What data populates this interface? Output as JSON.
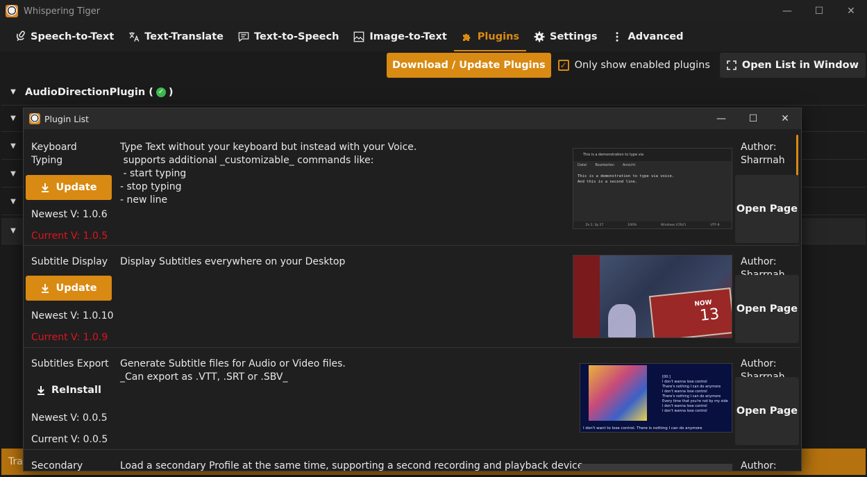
{
  "app": {
    "title": "Whispering Tiger",
    "window_controls": [
      "—",
      "☐",
      "✕"
    ]
  },
  "tabs": [
    {
      "label": "Speech-to-Text",
      "icon": "microphone-icon"
    },
    {
      "label": "Text-Translate",
      "icon": "translate-icon"
    },
    {
      "label": "Text-to-Speech",
      "icon": "speech-bubble-icon"
    },
    {
      "label": "Image-to-Text",
      "icon": "image-text-icon"
    },
    {
      "label": "Plugins",
      "icon": "puzzle-icon",
      "active": true
    },
    {
      "label": "Settings",
      "icon": "gear-icon"
    },
    {
      "label": "Advanced",
      "icon": "more-vertical-icon"
    }
  ],
  "toolbar": {
    "download_label": "Download / Update Plugins",
    "only_enabled_label": "Only show enabled plugins",
    "only_enabled_checked": true,
    "open_list_label": "Open List in Window"
  },
  "plugin_rows": [
    {
      "title": "AudioDirectionPlugin (",
      "status_close": ")",
      "enabled": true
    }
  ],
  "bottom_bar": {
    "text": "Tra"
  },
  "popup": {
    "title": "Plugin List",
    "entries": [
      {
        "name": "Keyboard\nTyping",
        "action": "Update",
        "newest": "Newest V: 1.0.6",
        "current": "Current V: 1.0.5",
        "outdated": true,
        "description": "Type Text without your keyboard but instead with your Voice.\n supports additional _customizable_ commands like:\n - start typing\n- stop typing\n- new line",
        "author": "Author:\nSharrnah",
        "open_label": "Open Page",
        "thumb": {
          "tab_title": "This is a demonstration to type via",
          "menu": [
            "Datei",
            "Bearbeiten",
            "Ansicht"
          ],
          "text": "This is a demonstration to type via voice.\nAnd this is a second line.",
          "status": [
            "Ze 2, Sp 27",
            "100%",
            "Windows (CRLF)",
            "UTF-8"
          ]
        }
      },
      {
        "name": "Subtitle Display",
        "action": "Update",
        "newest": "Newest V: 1.0.10",
        "current": "Current V: 1.0.9",
        "outdated": true,
        "description": "Display Subtitles everywhere on your Desktop",
        "author": "Author:\nSharrnah",
        "open_label": "Open Page",
        "thumb": {
          "caption": "NOW",
          "number": "13"
        }
      },
      {
        "name": "Subtitles Export",
        "action": "ReInstall",
        "newest": "Newest V: 0.0.5",
        "current": "Current V: 0.0.5",
        "outdated": false,
        "description": "Generate Subtitle files for Audio or Video files.\n_Can export as .VTT, .SRT or .SBV_",
        "author": "Author:\nSharrnah",
        "open_label": "Open Page",
        "thumb": {
          "lines": [
            "[00:]",
            "I don't wanna lose control",
            "There's nothing I can do anymore",
            "I don't wanna lose control",
            "There's nothing I can do anymore",
            "Every time that you're not by my side",
            "I don't wanna lose control",
            "I don't wanna lose control"
          ],
          "caption": "I don't want to lose control. There is nothing I can do anymore"
        }
      },
      {
        "name": "Secondary",
        "description": "Load a secondary Profile at the same time, supporting a second recording and playback device",
        "author": "Author:"
      }
    ]
  }
}
